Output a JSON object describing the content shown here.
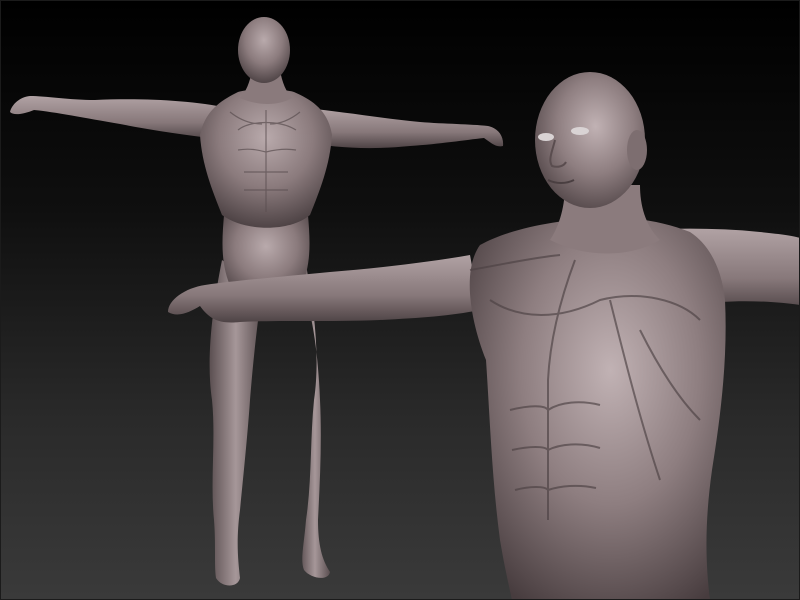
{
  "scene": {
    "subject": "anatomical-figure-sculpt",
    "background_top": "#000000",
    "background_bottom": "#3a3a3a",
    "skin_base": "#8a7a7c",
    "skin_light": "#b7a8aa",
    "skin_shadow": "#4e4345"
  }
}
